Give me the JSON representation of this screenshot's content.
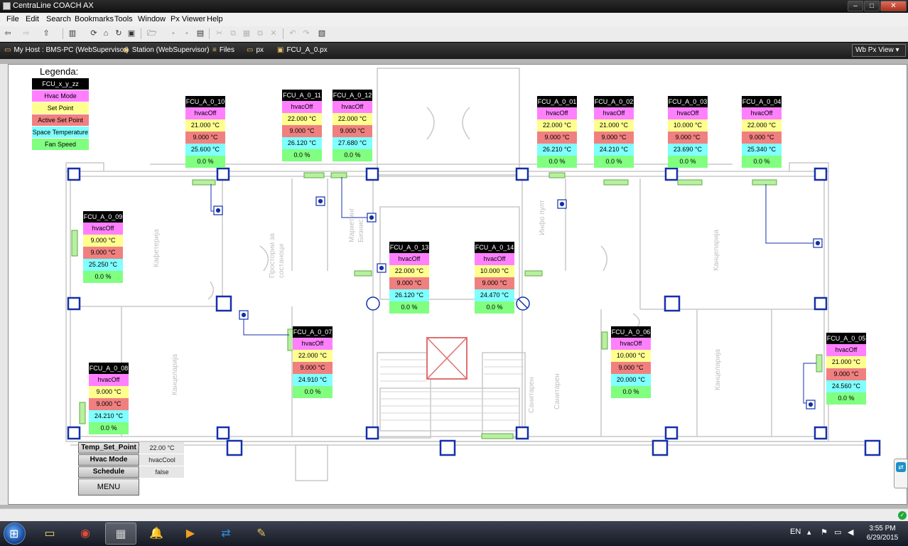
{
  "window": {
    "title": "CentraLine COACH AX",
    "min": "–",
    "max": "□",
    "close": "✕"
  },
  "menu": [
    "File",
    "Edit",
    "Search",
    "Bookmarks",
    "Tools",
    "Window",
    "Px Viewer",
    "Help"
  ],
  "breadcrumb": [
    {
      "label": "My Host : BMS-PC (WebSupervisor)",
      "icon": "host-icon"
    },
    {
      "label": "Station (WebSupervisor)",
      "icon": "station-icon"
    },
    {
      "label": "Files",
      "icon": "files-icon"
    },
    {
      "label": "px",
      "icon": "folder-icon"
    },
    {
      "label": "FCU_A_0.px",
      "icon": "px-file-icon"
    }
  ],
  "view_selector": {
    "label": "Wb Px View"
  },
  "legend": {
    "title": "Legenda:",
    "items": [
      "FCU_x_y_zz",
      "Hvac Mode",
      "Set Point",
      "Active Set Point",
      "Space Temperature",
      "Fan Speed"
    ],
    "colors": [
      "#000000",
      "#ff80ff",
      "#ffff90",
      "#f08080",
      "#80ffff",
      "#80ff80"
    ]
  },
  "fcus": [
    {
      "name": "FCU_A_0_10",
      "mode": "hvacOff",
      "setpoint": "21.000 °C",
      "active_setpoint": "9.000 °C",
      "space_temp": "25.600 °C",
      "fan": "0.0 %"
    },
    {
      "name": "FCU_A_0_11",
      "mode": "hvacOff",
      "setpoint": "22.000 °C",
      "active_setpoint": "9.000 °C",
      "space_temp": "26.120 °C",
      "fan": "0.0 %"
    },
    {
      "name": "FCU_A_0_12",
      "mode": "hvacOff",
      "setpoint": "22.000 °C",
      "active_setpoint": "9.000 °C",
      "space_temp": "27.680 °C",
      "fan": "0.0 %"
    },
    {
      "name": "FCU_A_0_01",
      "mode": "hvacOff",
      "setpoint": "22.000 °C",
      "active_setpoint": "9.000 °C",
      "space_temp": "26.210 °C",
      "fan": "0.0 %"
    },
    {
      "name": "FCU_A_0_02",
      "mode": "hvacOff",
      "setpoint": "21.000 °C",
      "active_setpoint": "9.000 °C",
      "space_temp": "24.210 °C",
      "fan": "0.0 %"
    },
    {
      "name": "FCU_A_0_03",
      "mode": "hvacOff",
      "setpoint": "10.000 °C",
      "active_setpoint": "9.000 °C",
      "space_temp": "23.690 °C",
      "fan": "0.0 %"
    },
    {
      "name": "FCU_A_0_04",
      "mode": "hvacOff",
      "setpoint": "22.000 °C",
      "active_setpoint": "9.000 °C",
      "space_temp": "25.340 °C",
      "fan": "0.0 %"
    },
    {
      "name": "FCU_A_0_09",
      "mode": "hvacOff",
      "setpoint": "9.000 °C",
      "active_setpoint": "9.000 °C",
      "space_temp": "25.250 °C",
      "fan": "0.0 %"
    },
    {
      "name": "FCU_A_0_13",
      "mode": "hvacOff",
      "setpoint": "22.000 °C",
      "active_setpoint": "9.000 °C",
      "space_temp": "26.120 °C",
      "fan": "0.0 %"
    },
    {
      "name": "FCU_A_0_14",
      "mode": "hvacOff",
      "setpoint": "10.000 °C",
      "active_setpoint": "9.000 °C",
      "space_temp": "24.470 °C",
      "fan": "0.0 %"
    },
    {
      "name": "FCU_A_0_07",
      "mode": "hvacOff",
      "setpoint": "22.000 °C",
      "active_setpoint": "9.000 °C",
      "space_temp": "24.910 °C",
      "fan": "0.0 %"
    },
    {
      "name": "FCU_A_0_06",
      "mode": "hvacOff",
      "setpoint": "10.000 °C",
      "active_setpoint": "9.000 °C",
      "space_temp": "20.000 °C",
      "fan": "0.0 %"
    },
    {
      "name": "FCU_A_0_05",
      "mode": "hvacOff",
      "setpoint": "21.000 °C",
      "active_setpoint": "9.000 °C",
      "space_temp": "24.560 °C",
      "fan": "0.0 %"
    },
    {
      "name": "FCU_A_0_08",
      "mode": "hvacOff",
      "setpoint": "9.000 °C",
      "active_setpoint": "9.000 °C",
      "space_temp": "24.210 °C",
      "fan": "0.0 %"
    }
  ],
  "controls": {
    "temp_set_point": {
      "label": "Temp_Set_Point",
      "value": "22.00 °C"
    },
    "hvac_mode": {
      "label": "Hvac Mode",
      "value": "hvacCool"
    },
    "schedule": {
      "label": "Schedule",
      "value": "false"
    },
    "menu_label": "MENU"
  },
  "taskbar": {
    "language": "EN",
    "time": "3:55 PM",
    "date": "6/29/2015",
    "apps": [
      "explorer-icon",
      "chrome-icon",
      "niagara-icon",
      "bell-icon",
      "media-icon",
      "teamviewer-icon",
      "paint-icon"
    ]
  }
}
